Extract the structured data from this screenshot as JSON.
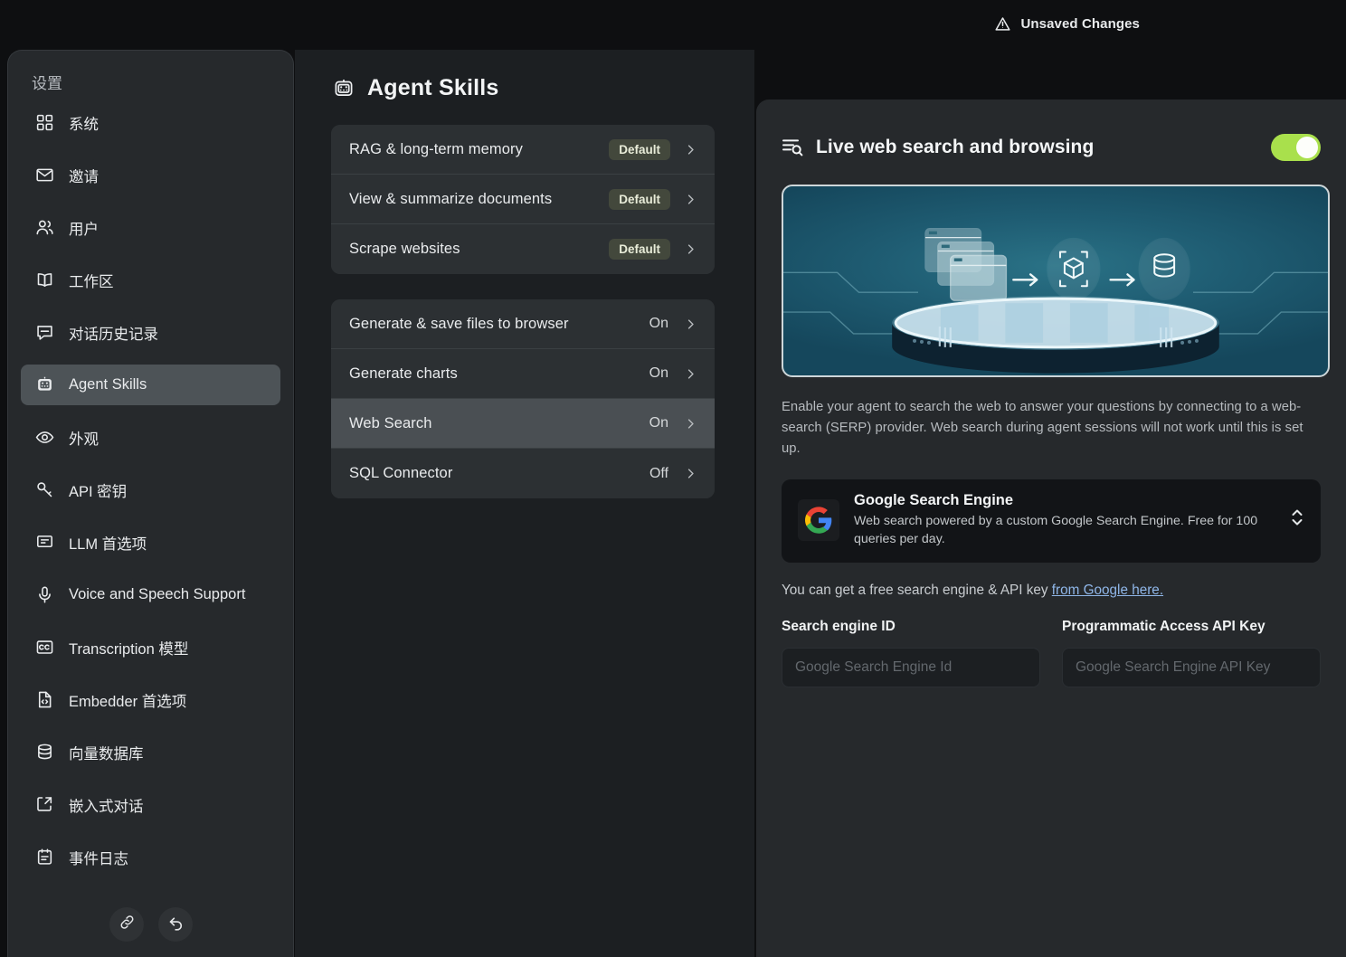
{
  "topbar": {
    "unsaved_label": "Unsaved Changes",
    "warning_icon": "warning-triangle-icon"
  },
  "sidebar": {
    "title": "设置",
    "items": [
      {
        "label": "系统",
        "icon": "grid-icon"
      },
      {
        "label": "邀请",
        "icon": "envelope-icon"
      },
      {
        "label": "用户",
        "icon": "users-icon"
      },
      {
        "label": "工作区",
        "icon": "book-open-icon"
      },
      {
        "label": "对话历史记录",
        "icon": "chat-bubble-icon"
      },
      {
        "label": "Agent Skills",
        "icon": "robot-icon"
      },
      {
        "label": "外观",
        "icon": "eye-icon"
      },
      {
        "label": "API 密钥",
        "icon": "key-icon"
      },
      {
        "label": "LLM 首选项",
        "icon": "chat-text-icon"
      },
      {
        "label": "Voice and Speech Support",
        "icon": "microphone-icon"
      },
      {
        "label": "Transcription 模型",
        "icon": "closed-caption-icon"
      },
      {
        "label": "Embedder 首选项",
        "icon": "file-code-icon"
      },
      {
        "label": "向量数据库",
        "icon": "database-icon"
      },
      {
        "label": "嵌入式对话",
        "icon": "embed-chat-icon"
      },
      {
        "label": "事件日志",
        "icon": "clipboard-list-icon"
      }
    ],
    "active_index": 5,
    "footer": [
      {
        "icon": "link-icon",
        "name": "link-button"
      },
      {
        "icon": "undo-arrow-icon",
        "name": "back-button"
      }
    ]
  },
  "skills_panel": {
    "title": "Agent Skills",
    "title_icon": "robot-icon",
    "groups": [
      {
        "rows": [
          {
            "label": "RAG & long-term memory",
            "state": "Default",
            "state_kind": "badge"
          },
          {
            "label": "View & summarize documents",
            "state": "Default",
            "state_kind": "badge"
          },
          {
            "label": "Scrape websites",
            "state": "Default",
            "state_kind": "badge"
          }
        ]
      },
      {
        "rows": [
          {
            "label": "Generate & save files to browser",
            "state": "On",
            "state_kind": "text"
          },
          {
            "label": "Generate charts",
            "state": "On",
            "state_kind": "text"
          },
          {
            "label": "Web Search",
            "state": "On",
            "state_kind": "text",
            "selected": true
          },
          {
            "label": "SQL Connector",
            "state": "Off",
            "state_kind": "text"
          }
        ]
      }
    ]
  },
  "detail": {
    "title": "Live web search and browsing",
    "title_icon": "search-document-icon",
    "toggle_on": true,
    "toggle_color": "#a9e04c",
    "hero_alt": "browser windows to cube to database flow illustration",
    "description": "Enable your agent to search the web to answer your questions by connecting to a web-search (SERP) provider. Web search during agent sessions will not work until this is set up.",
    "provider": {
      "name": "Google Search Engine",
      "description": "Web search powered by a custom Google Search Engine. Free for 100 queries per day.",
      "logo": "google-g-logo",
      "selector_icon": "up-down-chevron-icon"
    },
    "hint_text": "You can get a free search engine & API key ",
    "hint_link": "from Google here.",
    "fields": [
      {
        "label": "Search engine ID",
        "placeholder": "Google Search Engine Id",
        "value": ""
      },
      {
        "label": "Programmatic Access API Key",
        "placeholder": "Google Search Engine API Key",
        "value": ""
      }
    ]
  }
}
